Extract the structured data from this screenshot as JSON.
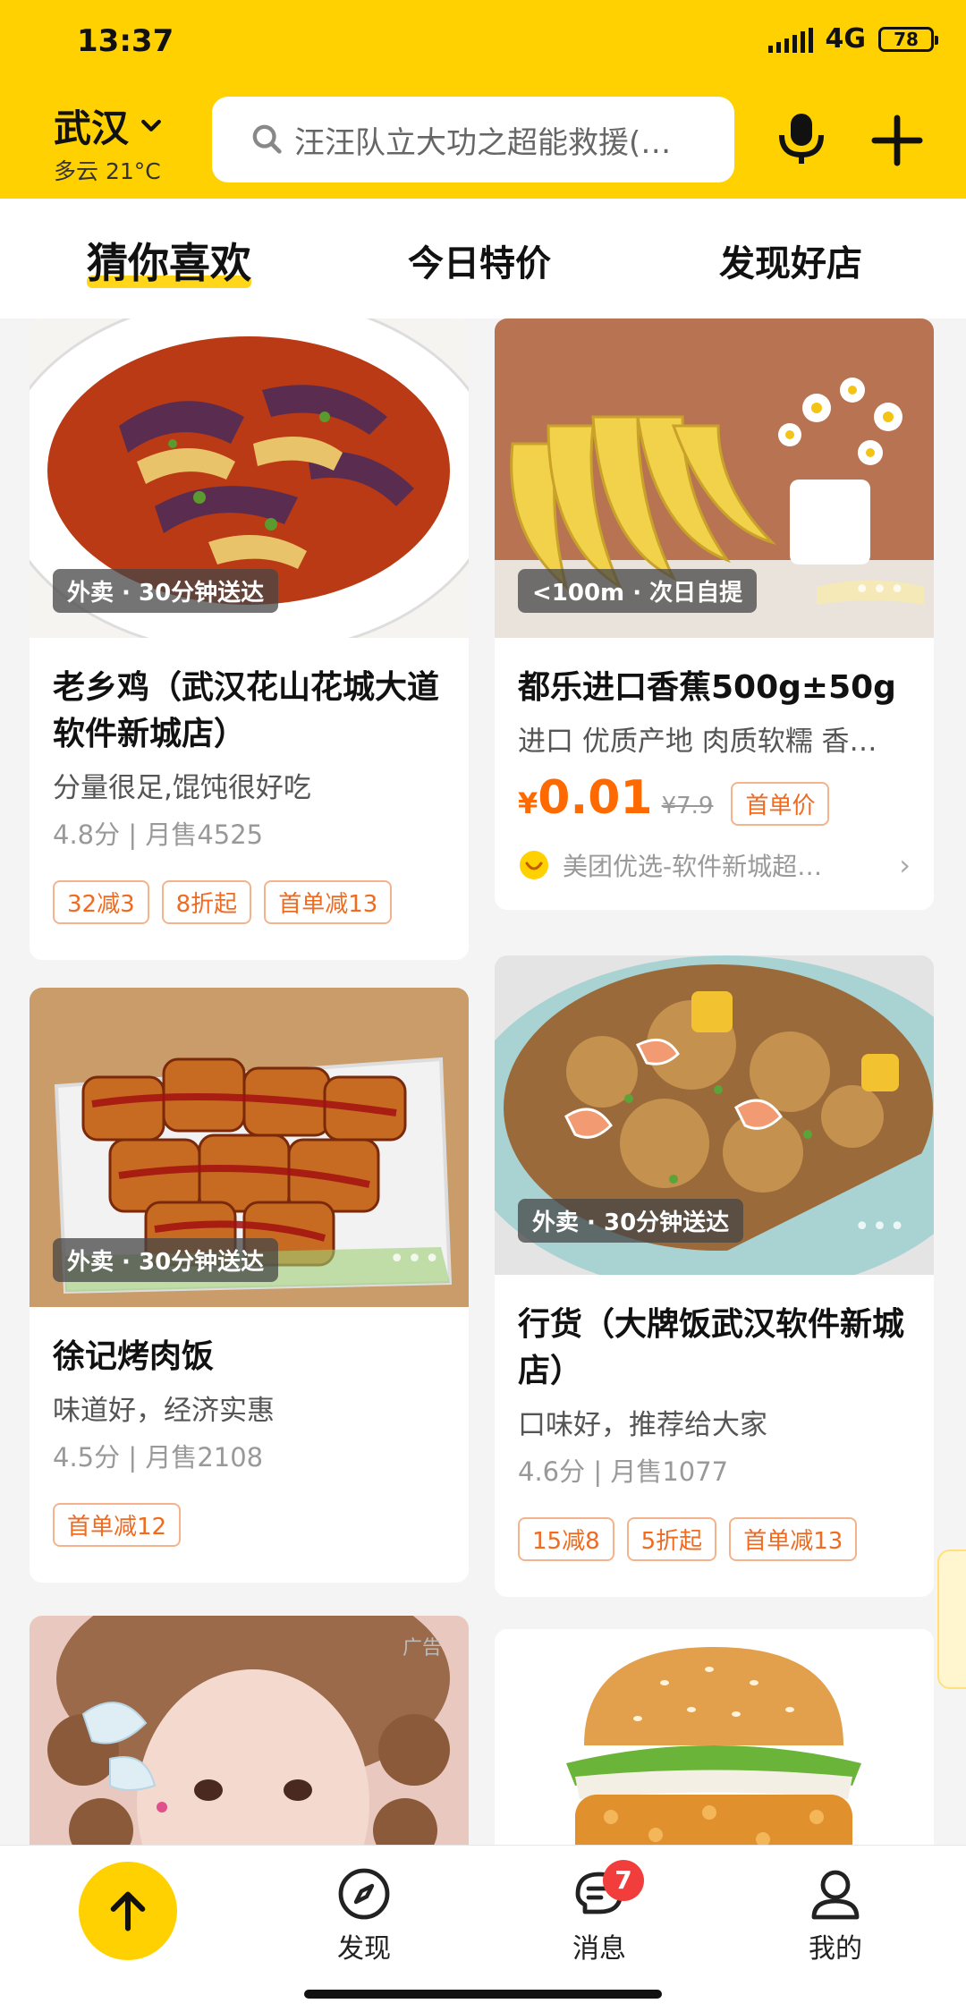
{
  "status": {
    "time": "13:37",
    "network": "4G",
    "battery": "78"
  },
  "header": {
    "city": "武汉",
    "weather": "多云 21°C",
    "search_placeholder": "汪汪队立大功之超能救援(…",
    "icons": [
      "chevron-down-icon",
      "search-icon",
      "mic-icon",
      "plus-icon"
    ]
  },
  "tabs": [
    "猜你喜欢",
    "今日特价",
    "发现好店"
  ],
  "feed": {
    "card1": {
      "badge": "外卖 · 30分钟送达",
      "title": "老乡鸡（武汉花山花城大道软件新城店）",
      "subtitle": "分量很足,馄饨很好吃",
      "rating": "4.8分 | 月售4525",
      "tags": [
        "32减3",
        "8折起",
        "首单减13"
      ]
    },
    "card2": {
      "badge": "<100m · 次日自提",
      "title": "都乐进口香蕉500g±50g",
      "subtitle": "进口 优质产地 肉质软糯 香…",
      "currency": "¥",
      "price": "0.01",
      "price_old": "¥7.9",
      "price_tag": "首单价",
      "store": "美团优选-软件新城超…",
      "store_chevron": "›"
    },
    "card3": {
      "badge": "外卖 · 30分钟送达",
      "title": "徐记烤肉饭",
      "subtitle": "味道好，经济实惠",
      "rating": "4.5分 | 月售2108",
      "tags": [
        "首单减12"
      ]
    },
    "card4": {
      "badge": "外卖 · 30分钟送达",
      "title": "行货（大牌饭武汉软件新城店）",
      "subtitle": "口味好，推荐给大家",
      "rating": "4.6分 | 月售1077",
      "tags": [
        "15减8",
        "5折起",
        "首单减13"
      ]
    },
    "card5": {
      "ad_label": "广告"
    },
    "dots": "•••"
  },
  "bottom_nav": {
    "items": [
      "发现",
      "消息",
      "我的"
    ],
    "message_count": "7",
    "icons": [
      "arrow-up-icon",
      "compass-icon",
      "chat-icon",
      "user-icon"
    ]
  },
  "colors": {
    "brand_yellow": "#FFD100",
    "price_orange": "#FF6A00",
    "badge_red": "#F23D3D"
  }
}
